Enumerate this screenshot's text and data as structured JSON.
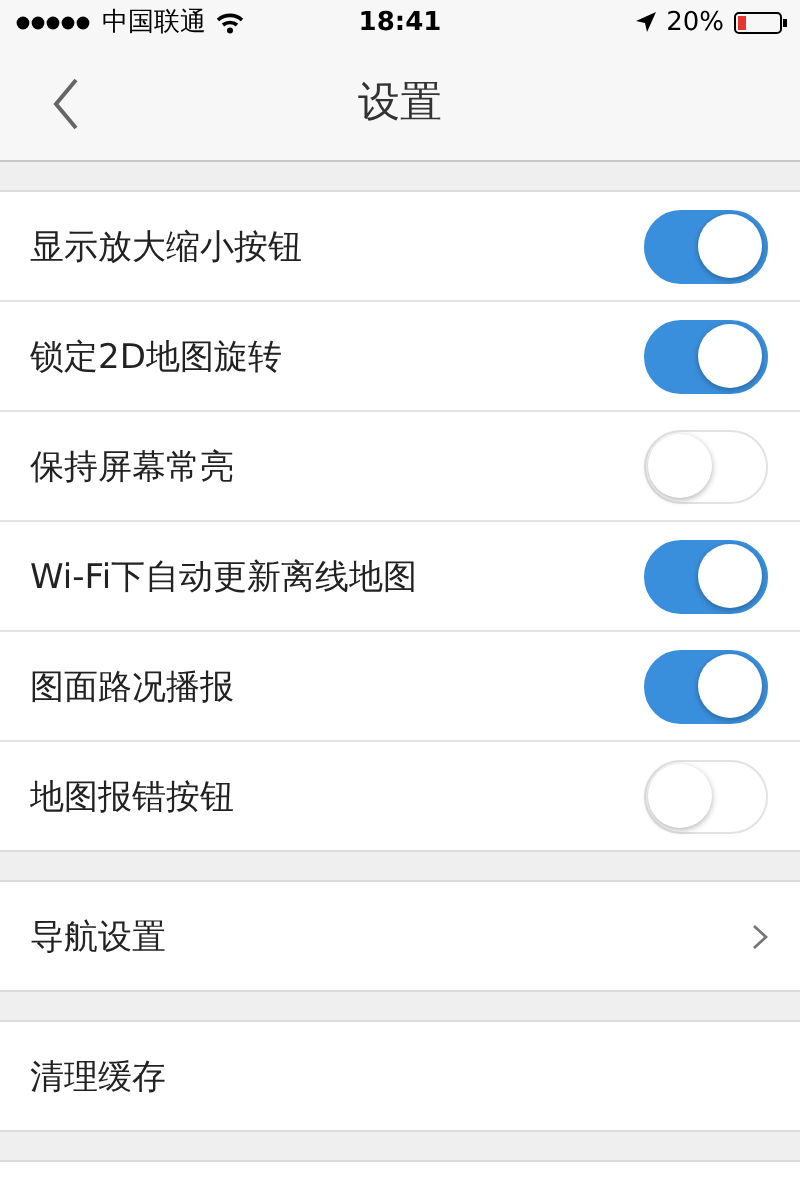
{
  "status_bar": {
    "carrier": "中国联通",
    "time": "18:41",
    "battery": "20%"
  },
  "nav_bar": {
    "title": "设置"
  },
  "groups": [
    {
      "items": [
        {
          "kind": "toggle",
          "label": "显示放大缩小按钮",
          "on": true
        },
        {
          "kind": "toggle",
          "label": "锁定2D地图旋转",
          "on": true
        },
        {
          "kind": "toggle",
          "label": "保持屏幕常亮",
          "on": false
        },
        {
          "kind": "toggle",
          "label": "Wi-Fi下自动更新离线地图",
          "on": true
        },
        {
          "kind": "toggle",
          "label": "图面路况播报",
          "on": true
        },
        {
          "kind": "toggle",
          "label": "地图报错按钮",
          "on": false
        }
      ]
    },
    {
      "items": [
        {
          "kind": "link",
          "label": "导航设置"
        }
      ]
    },
    {
      "items": [
        {
          "kind": "action",
          "label": "清理缓存"
        }
      ]
    },
    {
      "items": [
        {
          "kind": "blank"
        }
      ]
    }
  ]
}
